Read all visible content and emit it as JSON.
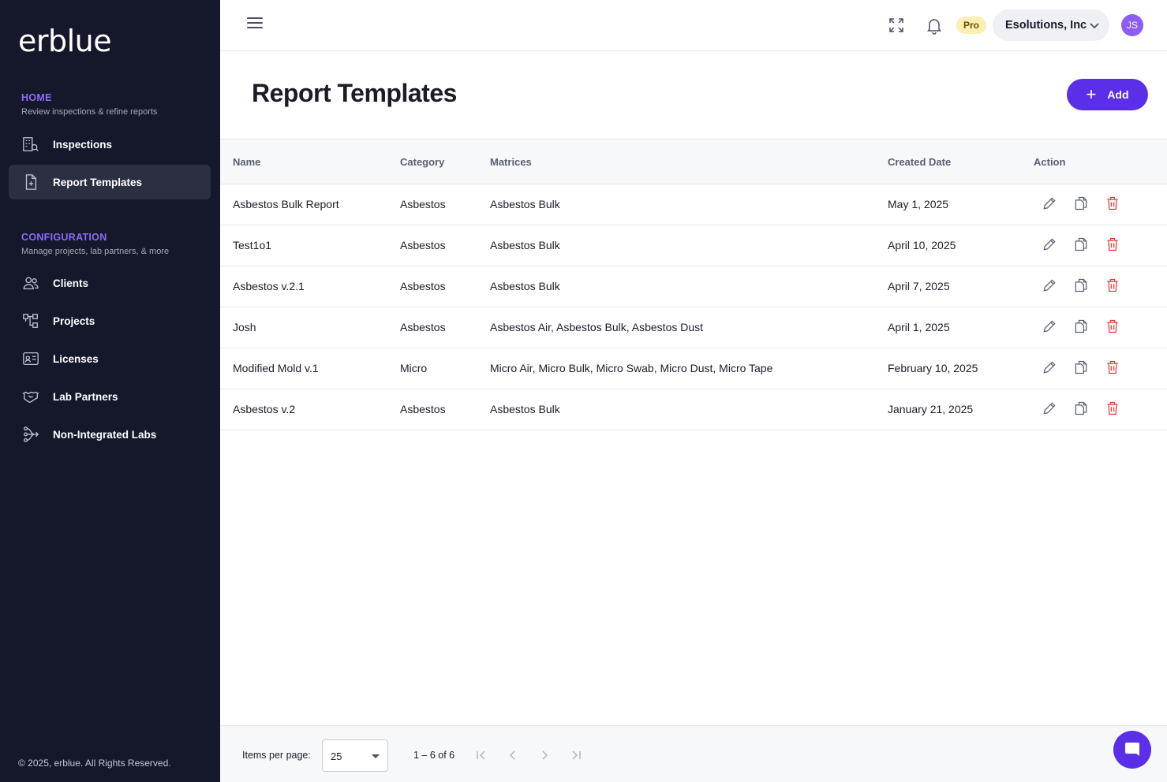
{
  "brand": {
    "logo_text": "erblue"
  },
  "sidebar": {
    "home_section": {
      "title": "HOME",
      "subtitle": "Review inspections & refine reports"
    },
    "config_section": {
      "title": "CONFIGURATION",
      "subtitle": "Manage projects, lab partners, & more"
    },
    "items": [
      {
        "label": "Inspections",
        "icon": "building-search-icon"
      },
      {
        "label": "Report Templates",
        "icon": "file-plus-icon",
        "active": true
      },
      {
        "label": "Clients",
        "icon": "users-icon"
      },
      {
        "label": "Projects",
        "icon": "hierarchy-icon"
      },
      {
        "label": "Licenses",
        "icon": "id-card-icon"
      },
      {
        "label": "Lab Partners",
        "icon": "handshake-icon"
      },
      {
        "label": "Non-Integrated Labs",
        "icon": "branch-arrow-icon"
      }
    ],
    "copyright": "© 2025, erblue. All Rights Reserved."
  },
  "topbar": {
    "plan_badge": "Pro",
    "organization": "Esolutions, Inc",
    "avatar_initials": "JS"
  },
  "page": {
    "title": "Report Templates",
    "add_label": "Add"
  },
  "table": {
    "columns": [
      "Name",
      "Category",
      "Matrices",
      "Created Date",
      "Action"
    ],
    "rows": [
      {
        "name": "Asbestos Bulk Report",
        "category": "Asbestos",
        "matrices": "Asbestos Bulk",
        "created": "May 1, 2025"
      },
      {
        "name": "Test1o1",
        "category": "Asbestos",
        "matrices": "Asbestos Bulk",
        "created": "April 10, 2025"
      },
      {
        "name": "Asbestos v.2.1",
        "category": "Asbestos",
        "matrices": "Asbestos Bulk",
        "created": "April 7, 2025"
      },
      {
        "name": "Josh",
        "category": "Asbestos",
        "matrices": "Asbestos Air, Asbestos Bulk, Asbestos Dust",
        "created": "April 1, 2025"
      },
      {
        "name": "Modified Mold v.1",
        "category": "Micro",
        "matrices": "Micro Air, Micro Bulk, Micro Swab, Micro Dust, Micro Tape",
        "created": "February 10, 2025"
      },
      {
        "name": "Asbestos v.2",
        "category": "Asbestos",
        "matrices": "Asbestos Bulk",
        "created": "January 21, 2025"
      }
    ]
  },
  "pagination": {
    "items_per_page_label": "Items per page:",
    "items_per_page": "25",
    "range": "1 – 6 of 6"
  },
  "colors": {
    "sidebar_bg": "#15172b",
    "accent": "#5b2ee8",
    "section_title": "#8c6bf5",
    "delete": "#e53935"
  }
}
